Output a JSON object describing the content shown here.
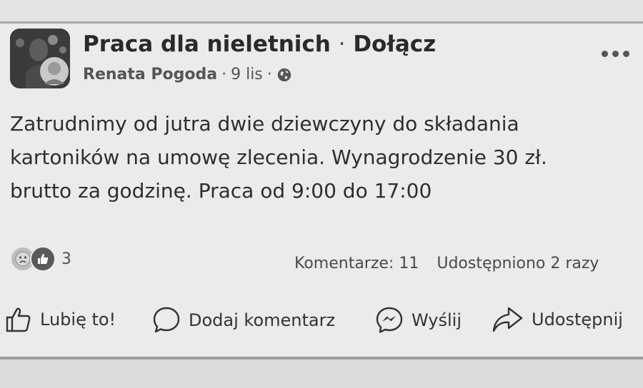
{
  "post": {
    "group_name": "Praca dla nieletnich",
    "separator": "·",
    "join_label": "Dołącz",
    "author": "Renata Pogoda",
    "meta_sep_1": "·",
    "date": "9 lis",
    "meta_sep_2": "·",
    "audience_icon": "globe-icon",
    "more_icon": "more-options-icon",
    "body_lines": [
      "Zatrudnimy od jutra dwie dziewczyny do składania",
      "kartoników na umowę zlecenia. Wynagrodzenie 30 zł.",
      "brutto za godzinę. Praca od 9:00 do 17:00"
    ]
  },
  "engagement": {
    "reaction_icons": [
      "sad-reaction-icon",
      "like-reaction-icon"
    ],
    "reaction_count": "3",
    "comments": "Komentarze: 11",
    "shares": "Udostępniono 2 razy"
  },
  "actions": {
    "like": "Lubię to!",
    "comment": "Dodaj komentarz",
    "send": "Wyślij",
    "share": "Udostępnij"
  },
  "colors": {
    "background": "#ebebeb",
    "text": "#2b2b2b",
    "muted": "#555555"
  }
}
